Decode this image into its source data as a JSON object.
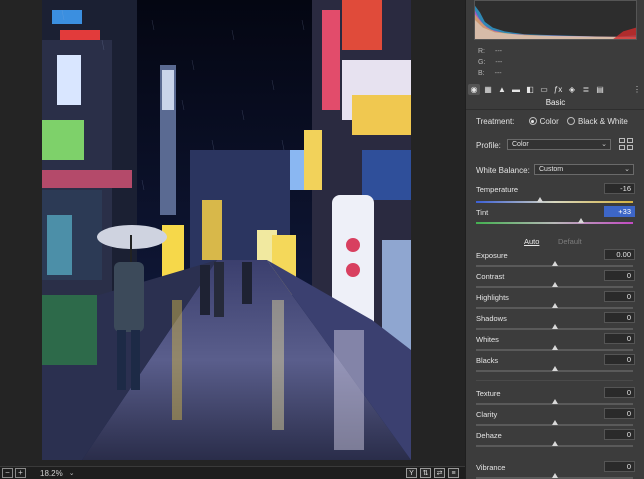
{
  "canvas": {
    "zoom": "18.2%"
  },
  "histogram": {
    "r": "---",
    "g": "---",
    "b": "---",
    "r_label": "R:",
    "g_label": "G:",
    "b_label": "B:"
  },
  "panel": {
    "section_title": "Basic",
    "treatment": {
      "label": "Treatment:",
      "options": [
        "Color",
        "Black & White"
      ],
      "selected": "Color"
    },
    "profile": {
      "label": "Profile:",
      "value": "Color"
    },
    "white_balance": {
      "label": "White Balance:",
      "value": "Custom"
    },
    "temperature": {
      "label": "Temperature",
      "value": "-16",
      "position": 0.41
    },
    "tint": {
      "label": "Tint",
      "value": "+33",
      "position": 0.67
    },
    "auto_label": "Auto",
    "default_label": "Default",
    "tone": [
      {
        "label": "Exposure",
        "value": "0.00",
        "position": 0.5
      },
      {
        "label": "Contrast",
        "value": "0",
        "position": 0.5
      },
      {
        "label": "Highlights",
        "value": "0",
        "position": 0.5
      },
      {
        "label": "Shadows",
        "value": "0",
        "position": 0.5
      },
      {
        "label": "Whites",
        "value": "0",
        "position": 0.5
      },
      {
        "label": "Blacks",
        "value": "0",
        "position": 0.5
      }
    ],
    "presence": [
      {
        "label": "Texture",
        "value": "0",
        "position": 0.5
      },
      {
        "label": "Clarity",
        "value": "0",
        "position": 0.5
      },
      {
        "label": "Dehaze",
        "value": "0",
        "position": 0.5
      },
      {
        "label": "Vibrance",
        "value": "0",
        "position": 0.5
      }
    ]
  },
  "icons": {
    "toolbar": [
      "basic-icon",
      "tone-curve-icon",
      "detail-icon",
      "hsl-icon",
      "split-toning-icon",
      "lens-icon",
      "effects-icon",
      "calibration-icon",
      "presets-icon",
      "snapshots-icon"
    ],
    "view": [
      "y-compare-icon",
      "swap-icon",
      "copy-icon",
      "settings-icon"
    ]
  },
  "colors": {
    "selected_value": "#3d66c7",
    "panel_bg": "#3c3c3c"
  }
}
